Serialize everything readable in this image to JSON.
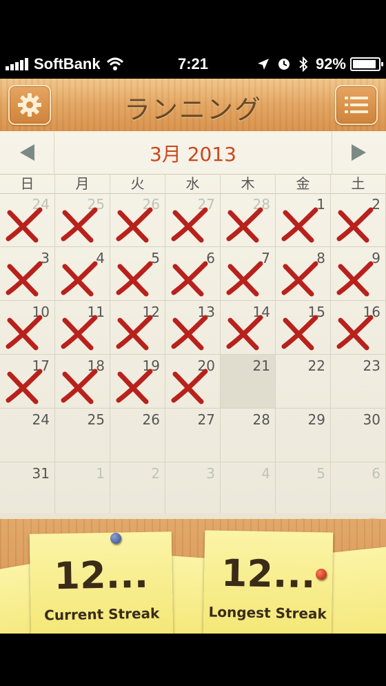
{
  "status_bar": {
    "carrier": "SoftBank",
    "time": "7:21",
    "battery": "92%",
    "battery_level": 0.92,
    "signal_bars": 5
  },
  "header": {
    "title": "ランニング",
    "settings_icon": "gear-icon",
    "menu_icon": "list-icon"
  },
  "calendar": {
    "month_label": "3月 2013",
    "prev_icon": "arrow-left-icon",
    "next_icon": "arrow-right-icon",
    "weekdays": [
      "日",
      "月",
      "火",
      "水",
      "木",
      "金",
      "土"
    ],
    "mark_color": "#b8211c",
    "weeks": [
      [
        {
          "day": "24",
          "dim": true,
          "marked": true
        },
        {
          "day": "25",
          "dim": true,
          "marked": true
        },
        {
          "day": "26",
          "dim": true,
          "marked": true
        },
        {
          "day": "27",
          "dim": true,
          "marked": true
        },
        {
          "day": "28",
          "dim": true,
          "marked": true
        },
        {
          "day": "1",
          "marked": true
        },
        {
          "day": "2",
          "marked": true
        }
      ],
      [
        {
          "day": "3",
          "marked": true
        },
        {
          "day": "4",
          "marked": true
        },
        {
          "day": "5",
          "marked": true
        },
        {
          "day": "6",
          "marked": true
        },
        {
          "day": "7",
          "marked": true
        },
        {
          "day": "8",
          "marked": true
        },
        {
          "day": "9",
          "marked": true
        }
      ],
      [
        {
          "day": "10",
          "marked": true
        },
        {
          "day": "11",
          "marked": true
        },
        {
          "day": "12",
          "marked": true
        },
        {
          "day": "13",
          "marked": true
        },
        {
          "day": "14",
          "marked": true
        },
        {
          "day": "15",
          "marked": true
        },
        {
          "day": "16",
          "marked": true
        }
      ],
      [
        {
          "day": "17",
          "marked": true
        },
        {
          "day": "18",
          "marked": true
        },
        {
          "day": "19",
          "marked": true
        },
        {
          "day": "20",
          "marked": true
        },
        {
          "day": "21",
          "today": true
        },
        {
          "day": "22"
        },
        {
          "day": "23"
        }
      ],
      [
        {
          "day": "24"
        },
        {
          "day": "25"
        },
        {
          "day": "26"
        },
        {
          "day": "27"
        },
        {
          "day": "28"
        },
        {
          "day": "29"
        },
        {
          "day": "30"
        }
      ],
      [
        {
          "day": "31"
        },
        {
          "day": "1",
          "dim": true
        },
        {
          "day": "2",
          "dim": true
        },
        {
          "day": "3",
          "dim": true
        },
        {
          "day": "4",
          "dim": true
        },
        {
          "day": "5",
          "dim": true
        },
        {
          "day": "6",
          "dim": true
        }
      ]
    ]
  },
  "streaks": {
    "current": {
      "value": "12...",
      "label": "Current Streak"
    },
    "longest": {
      "value": "12...",
      "label": "Longest Streak"
    }
  }
}
